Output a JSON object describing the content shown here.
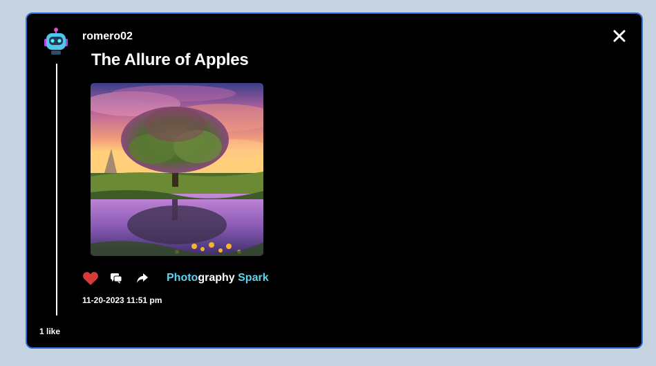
{
  "post": {
    "username": "romero02",
    "title": "The Allure of Apples",
    "timestamp": "11-20-2023 11:51 pm",
    "likes": "1 like",
    "tag": {
      "part1": "Photo",
      "part2": "graphy",
      "part3": " Spark"
    },
    "liked": true
  },
  "icons": {
    "avatar": "robot-avatar-icon",
    "close": "close-icon",
    "like": "heart-icon",
    "comment": "comment-icon",
    "share": "share-icon"
  },
  "colors": {
    "page_background": "#c5d2e0",
    "card_background": "#000000",
    "card_border": "#2f6fd8",
    "accent": "#5fd3f0",
    "heart": "#d83a3a"
  }
}
